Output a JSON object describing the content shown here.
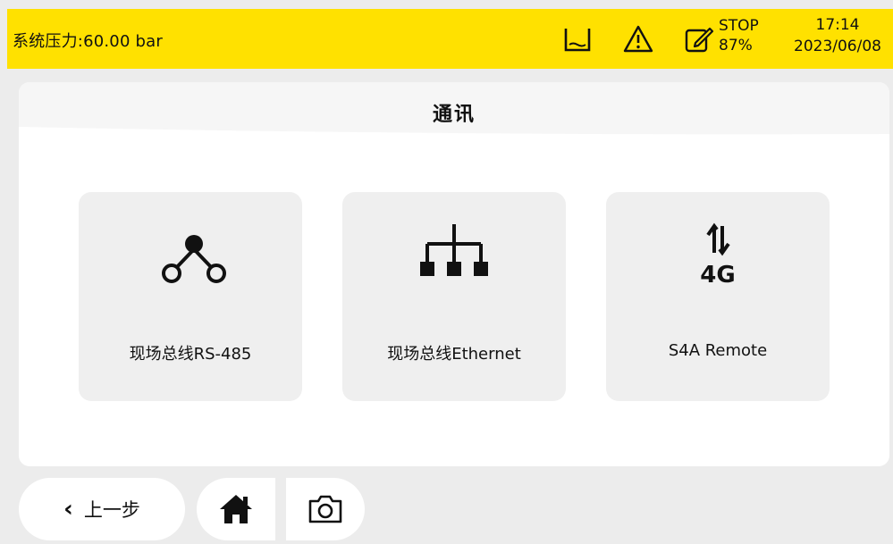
{
  "status": {
    "pressure_text": "系统压力:60.00 bar",
    "state_label": "STOP",
    "state_percent": "87%",
    "time": "17:14",
    "date": "2023/06/08",
    "background_color": "#ffe100",
    "icons": [
      "tank-icon",
      "warning-icon",
      "edit-icon"
    ]
  },
  "panel": {
    "title": "通讯"
  },
  "cards": [
    {
      "label": "现场总线RS-485",
      "icon": "rs485-network-icon"
    },
    {
      "label": "现场总线Ethernet",
      "icon": "ethernet-network-icon"
    },
    {
      "label": "S4A Remote",
      "icon_text": "4G",
      "icon": "4g-signal-icon"
    }
  ],
  "bottom": {
    "back_label": "上一步",
    "home_icon": "home-icon",
    "camera_icon": "camera-icon"
  }
}
